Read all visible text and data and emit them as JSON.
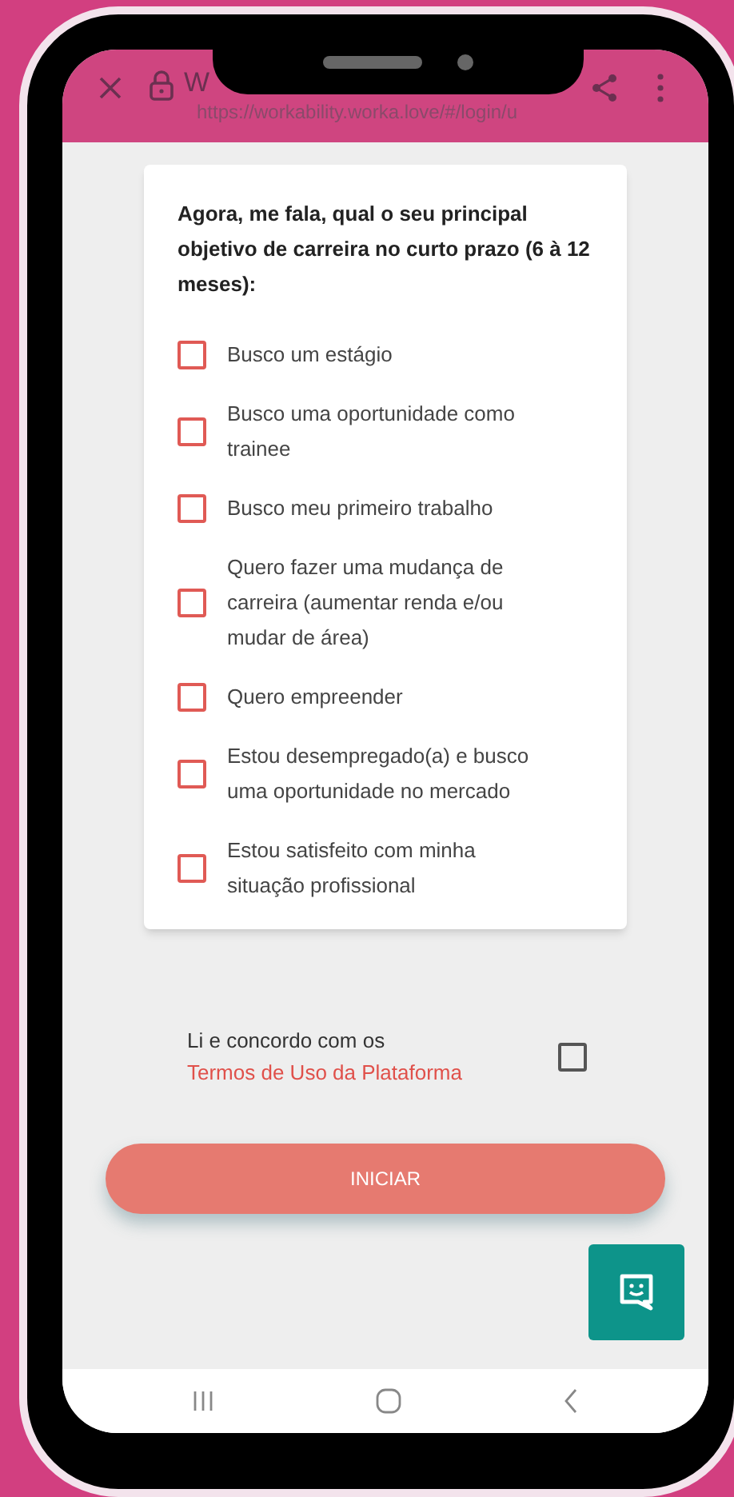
{
  "browser_bar": {
    "title": "W",
    "url": "https://workability.worka.love/#/login/u"
  },
  "question": {
    "title": "Agora, me fala, qual o seu principal objetivo de carreira no curto prazo (6 à 12 meses):",
    "options": [
      {
        "label": "Busco um estágio",
        "checked": false
      },
      {
        "label": "Busco uma oportunidade como trainee",
        "checked": false
      },
      {
        "label": "Busco meu primeiro trabalho",
        "checked": false
      },
      {
        "label": "Quero fazer uma mudança de carreira (aumentar renda e/ou mudar de área)",
        "checked": false
      },
      {
        "label": "Quero empreender",
        "checked": false
      },
      {
        "label": "Estou desempregado(a) e busco uma oportunidade no mercado",
        "checked": false
      },
      {
        "label": "Estou satisfeito com minha situação profissional",
        "checked": false
      }
    ]
  },
  "terms": {
    "text": "Li e concordo com os",
    "link": "Termos de Uso da Plataforma",
    "checked": false
  },
  "start_button": "INICIAR"
}
